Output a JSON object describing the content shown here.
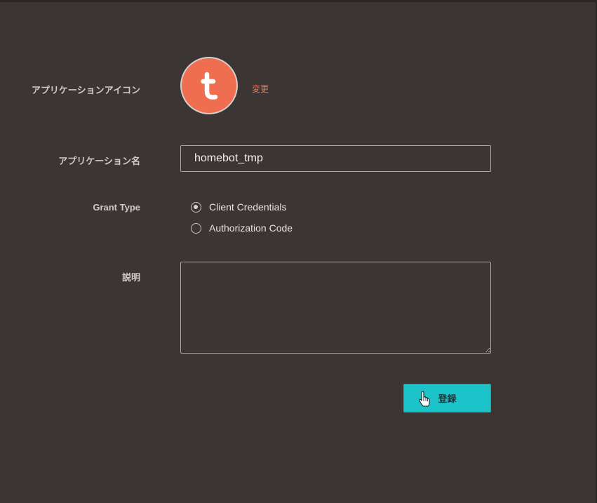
{
  "form": {
    "app_icon": {
      "label": "アプリケーションアイコン",
      "icon_letter": "t",
      "icon_color": "#f06e50",
      "change_label": "変更"
    },
    "app_name": {
      "label": "アプリケーション名",
      "value": "homebot_tmp"
    },
    "grant_type": {
      "label": "Grant Type",
      "options": [
        {
          "label": "Client Credentials",
          "selected": true
        },
        {
          "label": "Authorization Code",
          "selected": false
        }
      ]
    },
    "description": {
      "label": "説明",
      "value": ""
    },
    "submit_label": "登録"
  },
  "colors": {
    "background": "#3b3533",
    "accent": "#1cc3c8",
    "link": "#f07a5c"
  },
  "icons": {
    "cursor": "hand-pointer-icon"
  }
}
